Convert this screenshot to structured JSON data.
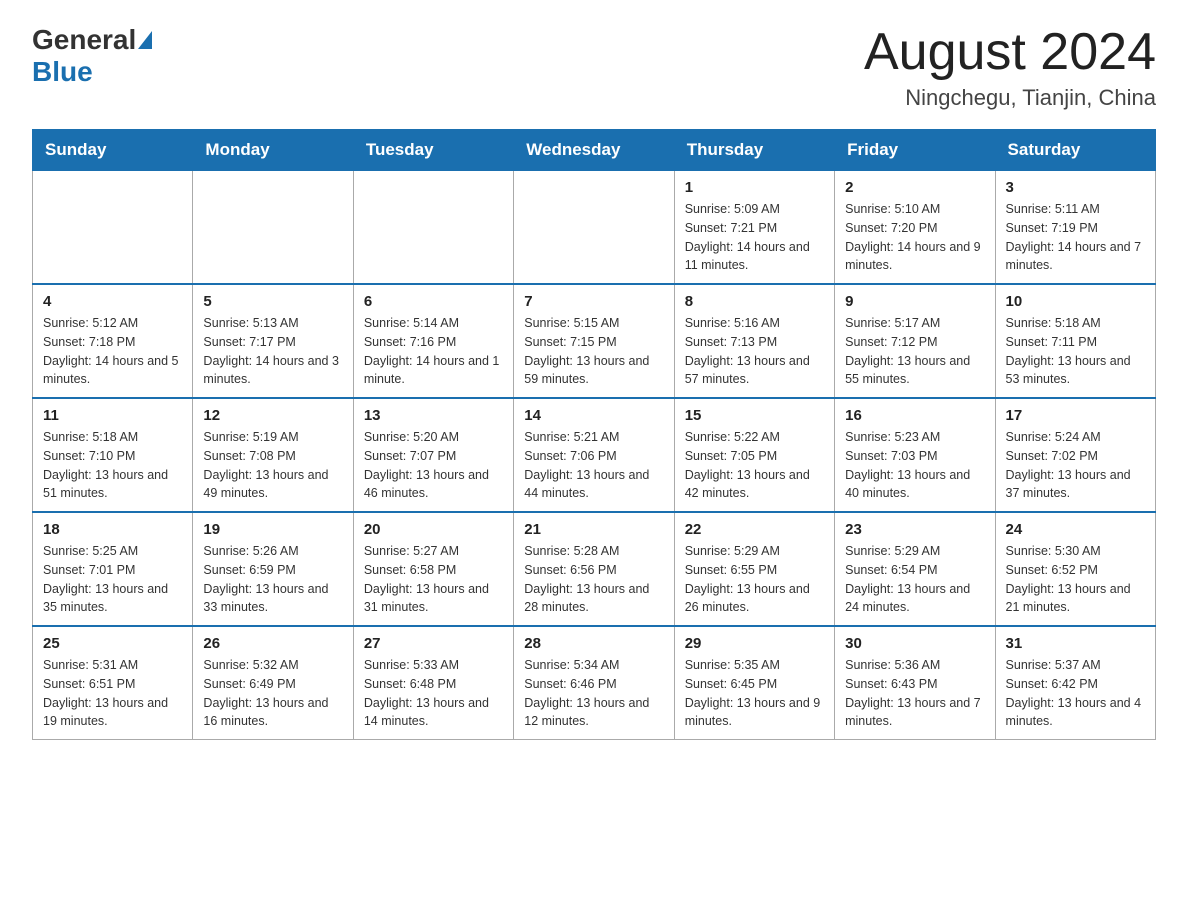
{
  "header": {
    "logo_general": "General",
    "logo_blue": "Blue",
    "month_title": "August 2024",
    "location": "Ningchegu, Tianjin, China"
  },
  "days_of_week": [
    "Sunday",
    "Monday",
    "Tuesday",
    "Wednesday",
    "Thursday",
    "Friday",
    "Saturday"
  ],
  "weeks": [
    [
      {
        "day": "",
        "info": ""
      },
      {
        "day": "",
        "info": ""
      },
      {
        "day": "",
        "info": ""
      },
      {
        "day": "",
        "info": ""
      },
      {
        "day": "1",
        "info": "Sunrise: 5:09 AM\nSunset: 7:21 PM\nDaylight: 14 hours and 11 minutes."
      },
      {
        "day": "2",
        "info": "Sunrise: 5:10 AM\nSunset: 7:20 PM\nDaylight: 14 hours and 9 minutes."
      },
      {
        "day": "3",
        "info": "Sunrise: 5:11 AM\nSunset: 7:19 PM\nDaylight: 14 hours and 7 minutes."
      }
    ],
    [
      {
        "day": "4",
        "info": "Sunrise: 5:12 AM\nSunset: 7:18 PM\nDaylight: 14 hours and 5 minutes."
      },
      {
        "day": "5",
        "info": "Sunrise: 5:13 AM\nSunset: 7:17 PM\nDaylight: 14 hours and 3 minutes."
      },
      {
        "day": "6",
        "info": "Sunrise: 5:14 AM\nSunset: 7:16 PM\nDaylight: 14 hours and 1 minute."
      },
      {
        "day": "7",
        "info": "Sunrise: 5:15 AM\nSunset: 7:15 PM\nDaylight: 13 hours and 59 minutes."
      },
      {
        "day": "8",
        "info": "Sunrise: 5:16 AM\nSunset: 7:13 PM\nDaylight: 13 hours and 57 minutes."
      },
      {
        "day": "9",
        "info": "Sunrise: 5:17 AM\nSunset: 7:12 PM\nDaylight: 13 hours and 55 minutes."
      },
      {
        "day": "10",
        "info": "Sunrise: 5:18 AM\nSunset: 7:11 PM\nDaylight: 13 hours and 53 minutes."
      }
    ],
    [
      {
        "day": "11",
        "info": "Sunrise: 5:18 AM\nSunset: 7:10 PM\nDaylight: 13 hours and 51 minutes."
      },
      {
        "day": "12",
        "info": "Sunrise: 5:19 AM\nSunset: 7:08 PM\nDaylight: 13 hours and 49 minutes."
      },
      {
        "day": "13",
        "info": "Sunrise: 5:20 AM\nSunset: 7:07 PM\nDaylight: 13 hours and 46 minutes."
      },
      {
        "day": "14",
        "info": "Sunrise: 5:21 AM\nSunset: 7:06 PM\nDaylight: 13 hours and 44 minutes."
      },
      {
        "day": "15",
        "info": "Sunrise: 5:22 AM\nSunset: 7:05 PM\nDaylight: 13 hours and 42 minutes."
      },
      {
        "day": "16",
        "info": "Sunrise: 5:23 AM\nSunset: 7:03 PM\nDaylight: 13 hours and 40 minutes."
      },
      {
        "day": "17",
        "info": "Sunrise: 5:24 AM\nSunset: 7:02 PM\nDaylight: 13 hours and 37 minutes."
      }
    ],
    [
      {
        "day": "18",
        "info": "Sunrise: 5:25 AM\nSunset: 7:01 PM\nDaylight: 13 hours and 35 minutes."
      },
      {
        "day": "19",
        "info": "Sunrise: 5:26 AM\nSunset: 6:59 PM\nDaylight: 13 hours and 33 minutes."
      },
      {
        "day": "20",
        "info": "Sunrise: 5:27 AM\nSunset: 6:58 PM\nDaylight: 13 hours and 31 minutes."
      },
      {
        "day": "21",
        "info": "Sunrise: 5:28 AM\nSunset: 6:56 PM\nDaylight: 13 hours and 28 minutes."
      },
      {
        "day": "22",
        "info": "Sunrise: 5:29 AM\nSunset: 6:55 PM\nDaylight: 13 hours and 26 minutes."
      },
      {
        "day": "23",
        "info": "Sunrise: 5:29 AM\nSunset: 6:54 PM\nDaylight: 13 hours and 24 minutes."
      },
      {
        "day": "24",
        "info": "Sunrise: 5:30 AM\nSunset: 6:52 PM\nDaylight: 13 hours and 21 minutes."
      }
    ],
    [
      {
        "day": "25",
        "info": "Sunrise: 5:31 AM\nSunset: 6:51 PM\nDaylight: 13 hours and 19 minutes."
      },
      {
        "day": "26",
        "info": "Sunrise: 5:32 AM\nSunset: 6:49 PM\nDaylight: 13 hours and 16 minutes."
      },
      {
        "day": "27",
        "info": "Sunrise: 5:33 AM\nSunset: 6:48 PM\nDaylight: 13 hours and 14 minutes."
      },
      {
        "day": "28",
        "info": "Sunrise: 5:34 AM\nSunset: 6:46 PM\nDaylight: 13 hours and 12 minutes."
      },
      {
        "day": "29",
        "info": "Sunrise: 5:35 AM\nSunset: 6:45 PM\nDaylight: 13 hours and 9 minutes."
      },
      {
        "day": "30",
        "info": "Sunrise: 5:36 AM\nSunset: 6:43 PM\nDaylight: 13 hours and 7 minutes."
      },
      {
        "day": "31",
        "info": "Sunrise: 5:37 AM\nSunset: 6:42 PM\nDaylight: 13 hours and 4 minutes."
      }
    ]
  ]
}
